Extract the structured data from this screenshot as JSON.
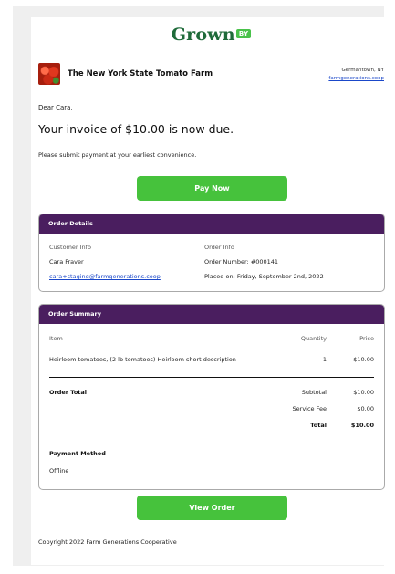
{
  "brand": {
    "logo_text": "Grown",
    "logo_badge": "BY",
    "logo_color": "#1f6b3a",
    "badge_color": "#49c24a"
  },
  "farm": {
    "name": "The New York State Tomato Farm",
    "location": "Germantown, NY",
    "website": "farmgenerations.coop"
  },
  "message": {
    "greeting": "Dear Cara,",
    "headline": "Your invoice of $10.00 is now due.",
    "body": "Please submit payment at your earliest convenience."
  },
  "buttons": {
    "pay_now": "Pay Now",
    "view_order": "View Order",
    "color": "#46c23c"
  },
  "order_details": {
    "title": "Order Details",
    "customer_label": "Customer Info",
    "customer_name": "Cara Fraver",
    "customer_email": "cara+staging@farmgenerations.coop",
    "order_label": "Order Info",
    "order_number": "Order Number: #000141",
    "placed_on": "Placed on: Friday, September 2nd, 2022"
  },
  "order_summary": {
    "title": "Order Summary",
    "columns": {
      "item": "Item",
      "quantity": "Quantity",
      "price": "Price"
    },
    "items": [
      {
        "name": "Heirloom tomatoes, (2 lb tomatoes) Heirloom short description",
        "quantity": "1",
        "price": "$10.00"
      }
    ],
    "total_label": "Order Total",
    "subtotal_label": "Subtotal",
    "subtotal": "$10.00",
    "service_fee_label": "Service Fee",
    "service_fee": "$0.00",
    "grand_total_label": "Total",
    "grand_total": "$10.00",
    "payment_method_label": "Payment Method",
    "payment_method": "Offline",
    "header_color": "#4a1e5f"
  },
  "footer": {
    "copyright": "Copyright 2022 Farm Generations Cooperative"
  }
}
